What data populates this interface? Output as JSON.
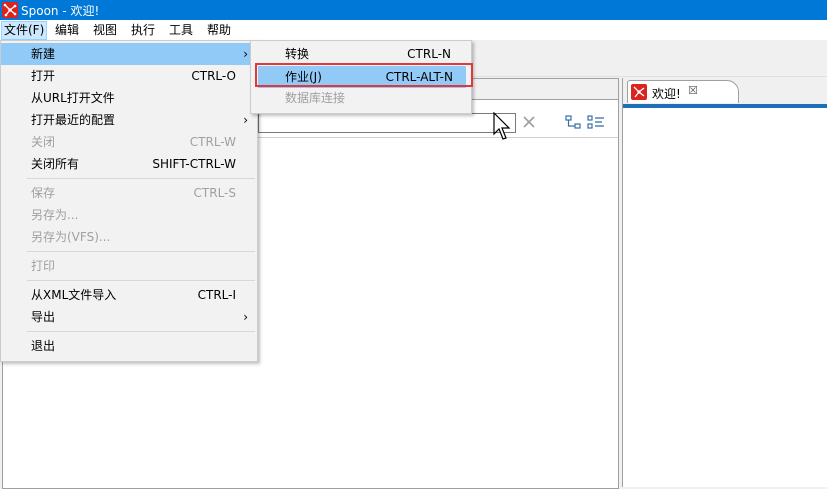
{
  "window": {
    "title": "Spoon - 欢迎!"
  },
  "menubar": {
    "items": [
      {
        "label": "文件(F)"
      },
      {
        "label": "编辑"
      },
      {
        "label": "视图"
      },
      {
        "label": "执行"
      },
      {
        "label": "工具"
      },
      {
        "label": "帮助"
      }
    ]
  },
  "file_menu": {
    "items": [
      {
        "label": "新建",
        "shortcut": "",
        "arrow": "›"
      },
      {
        "label": "打开",
        "shortcut": "CTRL-O"
      },
      {
        "label": "从URL打开文件",
        "shortcut": ""
      },
      {
        "label": "打开最近的配置",
        "shortcut": "",
        "arrow": "›"
      },
      {
        "label": "关闭",
        "shortcut": "CTRL-W"
      },
      {
        "label": "关闭所有",
        "shortcut": "SHIFT-CTRL-W"
      },
      {
        "label": "保存",
        "shortcut": "CTRL-S"
      },
      {
        "label": "另存为...",
        "shortcut": ""
      },
      {
        "label": "另存为(VFS)...",
        "shortcut": ""
      },
      {
        "label": "打印",
        "shortcut": ""
      },
      {
        "label": "从XML文件导入",
        "shortcut": "CTRL-I"
      },
      {
        "label": "导出",
        "shortcut": "",
        "arrow": "›"
      },
      {
        "label": "退出",
        "shortcut": ""
      }
    ]
  },
  "new_submenu": {
    "items": [
      {
        "label": "转换",
        "shortcut": "CTRL-N"
      },
      {
        "label": "作业(J)",
        "shortcut": "CTRL-ALT-N"
      },
      {
        "label": "数据库连接",
        "shortcut": ""
      }
    ]
  },
  "search": {
    "value": "",
    "clear_glyph": "✕"
  },
  "welcome_tab": {
    "label": "欢迎!",
    "close_glyph": "☒"
  },
  "colors": {
    "titlebar": "#0078d7",
    "menu_highlight": "#91c9f7",
    "red_box": "#e0383b",
    "tab_accent": "#1e6fb8"
  }
}
